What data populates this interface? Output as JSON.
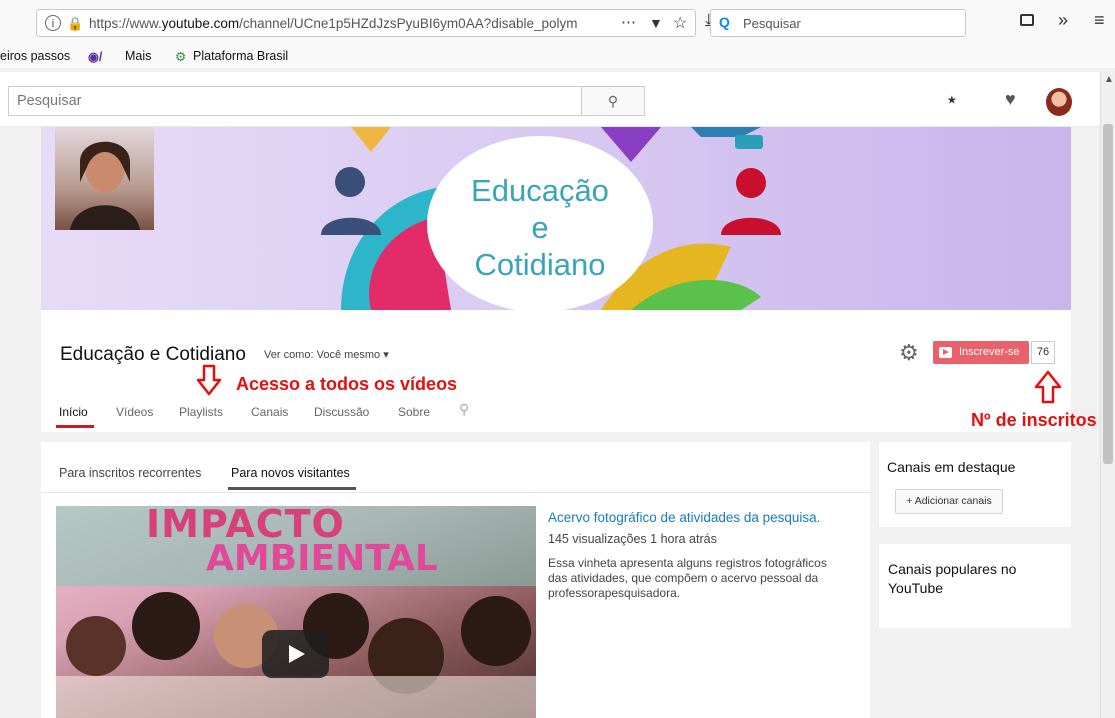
{
  "browser": {
    "url_prefix": "https://www.",
    "url_domain": "youtube.com",
    "url_path": "/channel/UCne1p5HZdJzsPyuBI6ym0AA?disable_polym",
    "search_placeholder": "Pesquisar",
    "bookmarks": [
      "eiros passos",
      "Mais",
      "Plataforma Brasil"
    ]
  },
  "masthead": {
    "search_placeholder": "Pesquisar"
  },
  "banner": {
    "title": "Educação\ne\nCotidiano"
  },
  "channel": {
    "name": "Educação e Cotidiano",
    "view_as_label": "Ver como:",
    "view_as_value": "Você mesmo",
    "subscribe_label": "Inscrever-se",
    "subscriber_count": "76",
    "tabs": [
      "Início",
      "Vídeos",
      "Playlists",
      "Canais",
      "Discussão",
      "Sobre"
    ]
  },
  "annotations": {
    "videos": "Acesso a todos os vídeos",
    "subscribers": "Nº de inscritos",
    "color": "#e41010"
  },
  "feed": {
    "tabs": [
      "Para inscritos recorrentes",
      "Para novos visitantes"
    ],
    "thumbnail_text_1": "IMPACTO",
    "thumbnail_text_2": "AMBIENTAL",
    "video": {
      "title": "Acervo fotográfico de atividades da pesquisa.",
      "meta": "145 visualizações  1 hora atrás",
      "description": "Essa vinheta apresenta alguns registros fotográficos das atividades, que compõem o acervo pessoal da professorapesquisadora."
    }
  },
  "sidebar": {
    "featured_title": "Canais em destaque",
    "add_channels_label": "+ Adicionar canais",
    "popular_title": "Canais populares no YouTube"
  },
  "colors": {
    "subscribe": "#e9616a",
    "link": "#167ac6",
    "tab_active": "#cc181e",
    "banner": "#c9b6ec"
  },
  "icons": [
    "info-icon",
    "lock-icon",
    "more-icon",
    "pocket-icon",
    "star-icon",
    "download-icon",
    "sidebar-icon",
    "overflow-icon",
    "menu-icon",
    "search-icon",
    "upload-icon",
    "bell-icon",
    "gear-icon",
    "play-icon"
  ]
}
